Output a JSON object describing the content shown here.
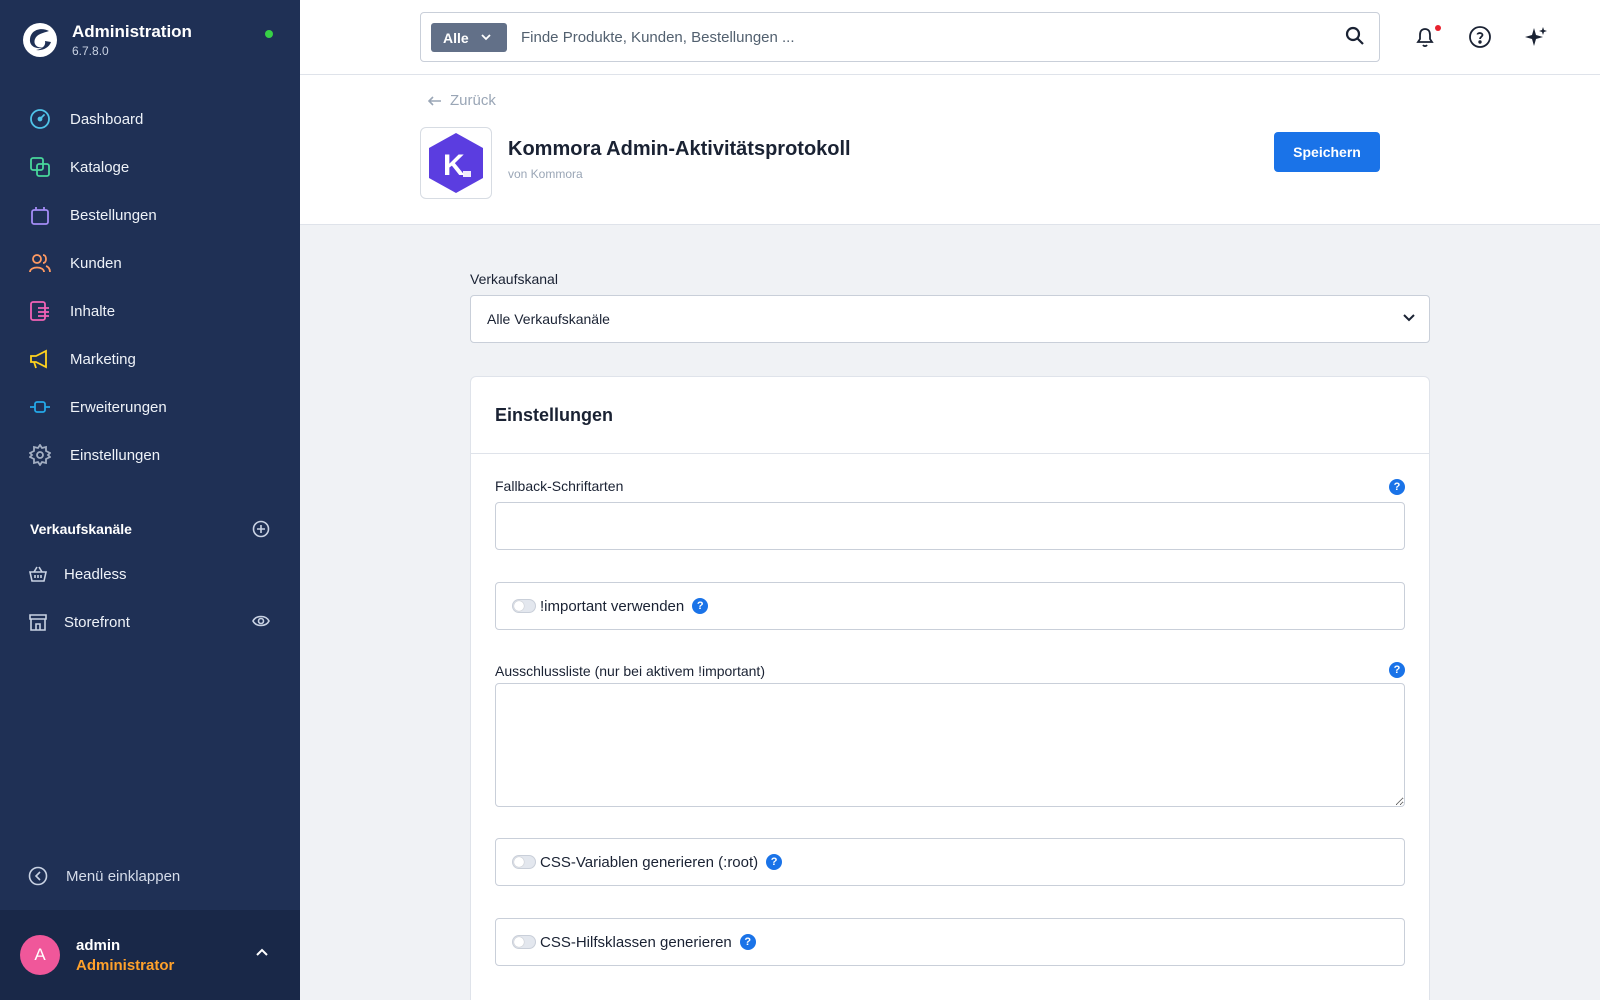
{
  "app": {
    "title": "Administration",
    "version": "6.7.8.0",
    "status_color": "#37d046"
  },
  "sidebar": {
    "items": [
      {
        "label": "Dashboard",
        "icon": "dashboard-gauge-icon",
        "color": "#4fc3e8"
      },
      {
        "label": "Kataloge",
        "icon": "catalog-stack-icon",
        "color": "#48d79b"
      },
      {
        "label": "Bestellungen",
        "icon": "shopping-bag-icon",
        "color": "#a48cf5"
      },
      {
        "label": "Kunden",
        "icon": "customers-icon",
        "color": "#ff9a62"
      },
      {
        "label": "Inhalte",
        "icon": "content-list-icon",
        "color": "#f062b6"
      },
      {
        "label": "Marketing",
        "icon": "megaphone-icon",
        "color": "#ffd21e"
      },
      {
        "label": "Erweiterungen",
        "icon": "plug-icon",
        "color": "#24a8e8"
      },
      {
        "label": "Einstellungen",
        "icon": "gear-icon",
        "color": "#a3aec2"
      }
    ],
    "sales_channels_title": "Verkaufskanäle",
    "sales_channels": [
      {
        "label": "Headless",
        "icon": "basket-icon"
      },
      {
        "label": "Storefront",
        "icon": "storefront-icon"
      }
    ],
    "collapse_label": "Menü einklappen"
  },
  "user": {
    "initial": "A",
    "name": "admin",
    "role": "Administrator"
  },
  "search": {
    "scope": "Alle",
    "placeholder": "Finde Produkte, Kunden, Bestellungen ..."
  },
  "header": {
    "back_label": "Zurück",
    "app_name": "Kommora Admin-Aktivitätsprotokoll",
    "vendor": "von Kommora",
    "logo_letter": "K",
    "save_label": "Speichern",
    "accent_color": "#1a73e8"
  },
  "form": {
    "sales_channel_label": "Verkaufskanal",
    "sales_channel_value": "Alle Verkaufskanäle",
    "card_title": "Einstellungen",
    "fallback_fonts_label": "Fallback-Schriftarten",
    "fallback_fonts_value": "",
    "important_label": "!important verwenden",
    "exclusion_label": "Ausschlussliste (nur bei aktivem !important)",
    "exclusion_value": "",
    "css_vars_label": "CSS-Variablen generieren (:root)",
    "css_helpers_label": "CSS-Hilfsklassen generieren",
    "help_glyph": "?"
  }
}
